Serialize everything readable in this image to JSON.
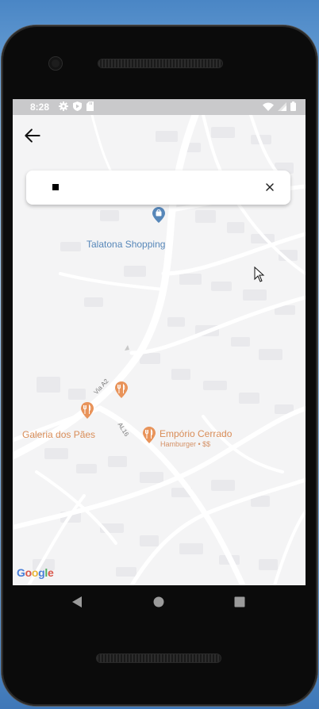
{
  "status_bar": {
    "time": "8:28",
    "left_icons": [
      "gear-icon",
      "shield-play-icon",
      "sd-card-icon"
    ],
    "right_icons": [
      "wifi-icon",
      "signal-icon",
      "battery-icon"
    ]
  },
  "top_bar": {
    "back_icon": "arrow-left-icon"
  },
  "search": {
    "value": "",
    "placeholder": "",
    "clear_icon": "close-icon"
  },
  "map": {
    "places": {
      "talatona": {
        "name": "Talatona Shopping",
        "icon": "shopping-bag-pin-icon",
        "color": "#5787b9"
      },
      "galeria": {
        "name": "Galeria dos Pães",
        "icon": "restaurant-pin-icon",
        "color": "#e8935a"
      },
      "emporio": {
        "name": "Empório Cerrado",
        "subtitle": "Hamburger • $$",
        "icon": "restaurant-pin-icon",
        "color": "#e8935a"
      },
      "unnamed_restaurant": {
        "icon": "restaurant-pin-icon",
        "color": "#e8935a"
      }
    },
    "roads": {
      "via_a2": "Via A2",
      "al16": "AL16"
    },
    "attribution": "Google"
  },
  "nav_bar": {
    "back_icon": "triangle-back-icon",
    "home_icon": "circle-home-icon",
    "recents_icon": "square-recents-icon"
  }
}
